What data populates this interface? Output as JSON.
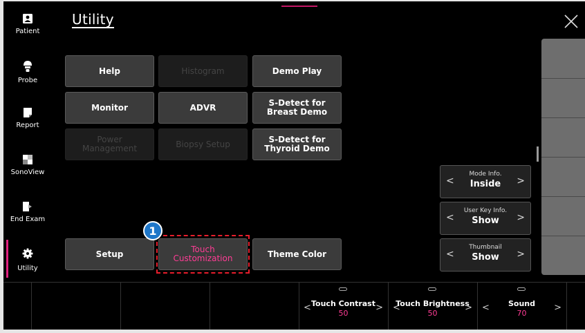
{
  "title": "Utility",
  "sidebar": {
    "items": [
      {
        "label": "Patient",
        "icon": "patient-icon"
      },
      {
        "label": "Probe",
        "icon": "probe-icon"
      },
      {
        "label": "Report",
        "icon": "report-icon"
      },
      {
        "label": "SonoView",
        "icon": "sonoview-icon"
      },
      {
        "label": "End Exam",
        "icon": "end-exam-icon"
      },
      {
        "label": "Utility",
        "icon": "gear-icon",
        "active": true
      }
    ]
  },
  "buttons": {
    "help": "Help",
    "histogram": "Histogram",
    "demo_play": "Demo Play",
    "monitor": "Monitor",
    "advr": "ADVR",
    "sdetect_breast": "S-Detect for Breast Demo",
    "power_management": "Power Management",
    "biopsy_setup": "Biopsy Setup",
    "sdetect_thyroid": "S-Detect for Thyroid Demo",
    "setup": "Setup",
    "touch_customization": "Touch Customization",
    "theme_color": "Theme Color"
  },
  "callout": "1",
  "selectors": [
    {
      "caption": "Mode Info.",
      "value": "Inside"
    },
    {
      "caption": "User Key Info.",
      "value": "Show"
    },
    {
      "caption": "Thumbnail",
      "value": "Show"
    }
  ],
  "knobs": [
    {
      "label": "Touch Contrast",
      "value": "50"
    },
    {
      "label": "Touch Brightness",
      "value": "50"
    },
    {
      "label": "Sound",
      "value": "70"
    }
  ],
  "arrows": {
    "left": "<",
    "right": ">"
  },
  "colors": {
    "accent": "#ff3c95",
    "highlight": "#e81e2c",
    "badge": "#1e76c8"
  }
}
